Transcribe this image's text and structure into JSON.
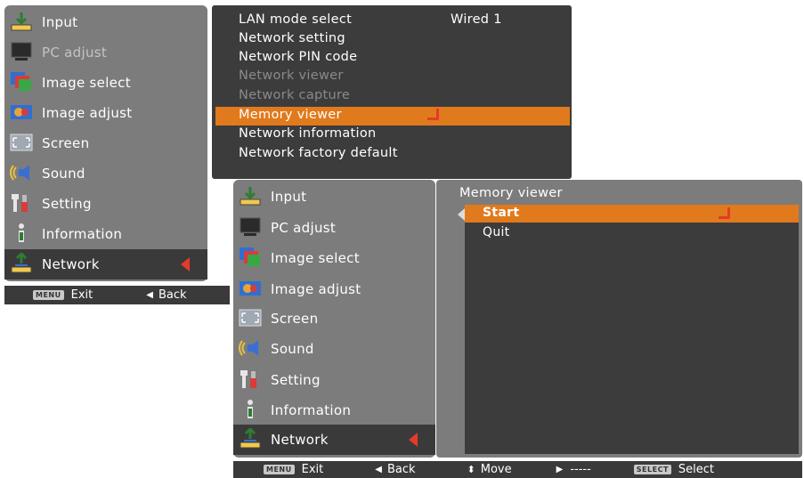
{
  "menu1": {
    "sidebar": [
      {
        "label": "Input",
        "icon": "input-icon",
        "state": "normal"
      },
      {
        "label": "PC adjust",
        "icon": "pc-adjust-icon",
        "state": "disabled"
      },
      {
        "label": "Image select",
        "icon": "image-select-icon",
        "state": "normal"
      },
      {
        "label": "Image adjust",
        "icon": "image-adjust-icon",
        "state": "normal"
      },
      {
        "label": "Screen",
        "icon": "screen-icon",
        "state": "normal"
      },
      {
        "label": "Sound",
        "icon": "sound-icon",
        "state": "normal"
      },
      {
        "label": "Setting",
        "icon": "setting-icon",
        "state": "normal"
      },
      {
        "label": "Information",
        "icon": "information-icon",
        "state": "normal"
      },
      {
        "label": "Network",
        "icon": "network-icon",
        "state": "active"
      }
    ],
    "network_menu": {
      "items": [
        {
          "label": "LAN mode select",
          "value": "Wired 1",
          "state": "normal"
        },
        {
          "label": "Network setting",
          "state": "normal"
        },
        {
          "label": "Network PIN code",
          "state": "normal"
        },
        {
          "label": "Network viewer",
          "state": "dim"
        },
        {
          "label": "Network capture",
          "state": "dim"
        },
        {
          "label": "Memory viewer",
          "state": "selected"
        },
        {
          "label": "Network information",
          "state": "normal"
        },
        {
          "label": "Network factory default",
          "state": "normal"
        }
      ]
    },
    "footer": {
      "menu_key": "MENU",
      "exit": "Exit",
      "back": "Back"
    }
  },
  "menu2": {
    "sidebar": [
      {
        "label": "Input",
        "icon": "input-icon",
        "state": "normal"
      },
      {
        "label": "PC adjust",
        "icon": "pc-adjust-icon",
        "state": "normal"
      },
      {
        "label": "Image select",
        "icon": "image-select-icon",
        "state": "normal"
      },
      {
        "label": "Image adjust",
        "icon": "image-adjust-icon",
        "state": "normal"
      },
      {
        "label": "Screen",
        "icon": "screen-icon",
        "state": "normal"
      },
      {
        "label": "Sound",
        "icon": "sound-icon",
        "state": "normal"
      },
      {
        "label": "Setting",
        "icon": "setting-icon",
        "state": "normal"
      },
      {
        "label": "Information",
        "icon": "information-icon",
        "state": "normal"
      },
      {
        "label": "Network",
        "icon": "network-icon",
        "state": "active"
      }
    ],
    "submenu": {
      "title": "Memory viewer",
      "items": [
        {
          "label": "Start",
          "state": "selected"
        },
        {
          "label": "Quit",
          "state": "normal"
        }
      ]
    },
    "footer": {
      "menu_key": "MENU",
      "exit": "Exit",
      "back": "Back",
      "move": "Move",
      "dashes": "-----",
      "select_key": "SELECT",
      "select": "Select"
    }
  },
  "colors": {
    "sidebar": "#7c7c7c",
    "menu_bg": "#3c3c3c",
    "highlight": "#e07a1c",
    "accent_red": "#e53a2a"
  }
}
